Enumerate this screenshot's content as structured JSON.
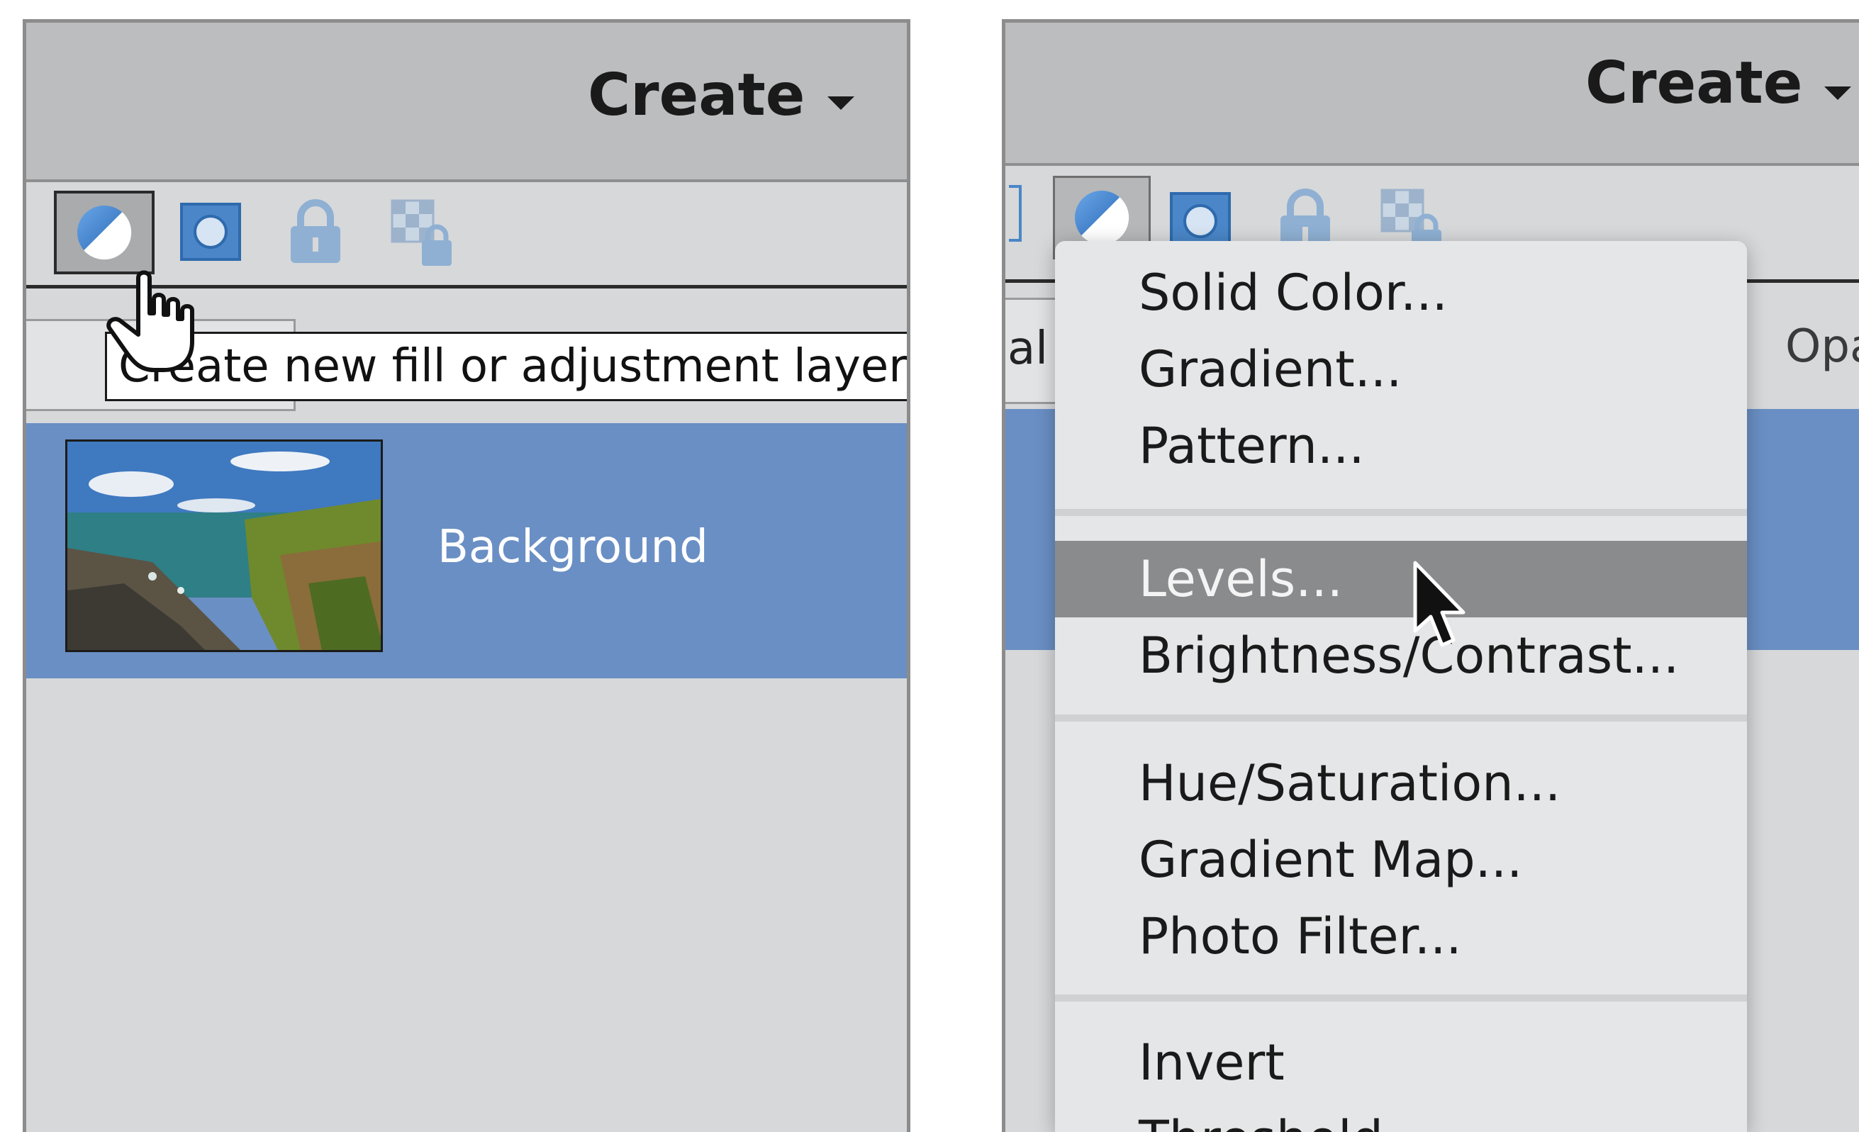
{
  "left_panel": {
    "create_label": "Create",
    "tooltip": "Create new fill or adjustment layer",
    "layer_name": "Background"
  },
  "right_panel": {
    "create_label": "Create",
    "blend_mode_partial": "al",
    "opacity_partial": "Opa",
    "menu": {
      "items": [
        "Solid Color...",
        "Gradient...",
        "Pattern...",
        "Levels...",
        "Brightness/Contrast...",
        "Hue/Saturation...",
        "Gradient Map...",
        "Photo Filter...",
        "Invert",
        "Threshold..."
      ],
      "highlighted": "Levels..."
    }
  },
  "icons": [
    "adjustment-layer-icon",
    "layer-mask-icon",
    "lock-icon",
    "lock-transparency-icon",
    "caret-down-icon",
    "hand-cursor-icon",
    "arrow-cursor-icon"
  ],
  "colors": {
    "panel_bg": "#d6d8da",
    "header_bg": "#bcbdbf",
    "selected_layer": "#6a8fc4",
    "menu_highlight": "#8a8b8d",
    "icon_blue": "#4a86c8"
  }
}
